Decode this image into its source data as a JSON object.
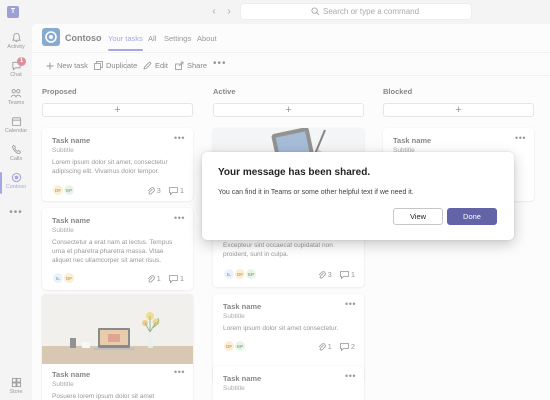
{
  "titlebar": {
    "search_placeholder": "Search or type a command"
  },
  "rail": {
    "items": [
      {
        "label": "Activity",
        "icon": "bell-icon"
      },
      {
        "label": "Chat",
        "icon": "chat-icon",
        "badge": "1"
      },
      {
        "label": "Teams",
        "icon": "teams-icon"
      },
      {
        "label": "Calendar",
        "icon": "calendar-icon"
      },
      {
        "label": "Calls",
        "icon": "phone-icon"
      },
      {
        "label": "Contoso",
        "icon": "contoso-app-icon"
      }
    ],
    "more": "•••",
    "store": "Store"
  },
  "app": {
    "name": "Contoso",
    "tabs": [
      "Your tasks",
      "All",
      "Settings",
      "About"
    ],
    "active_tab": "Your tasks"
  },
  "toolbar": {
    "new_task": "New task",
    "duplicate": "Duplicate",
    "edit": "Edit",
    "share": "Share",
    "more": "•••"
  },
  "columns": [
    {
      "title": "Proposed",
      "add": "+",
      "cards": [
        {
          "title": "Task name",
          "subtitle": "Subtitle",
          "desc": "Lorem ipsum dolor sit amet, consectetur adipiscing elit. Vivamus dolor tempor.",
          "avatars": [
            "DF",
            "EP"
          ],
          "attachments": "3",
          "comments": "1"
        },
        {
          "title": "Task name",
          "subtitle": "Subtitle",
          "desc": "Consectetur a erat nam at lectus. Tempus urna et pharetra pharetra massa. Vitae aliquet nec ullamcorper sit amet risus.",
          "avatars": [
            "IL",
            "DF"
          ],
          "attachments": "1",
          "comments": "1"
        },
        {
          "title": "Task name",
          "subtitle": "Subtitle",
          "desc": "Posuere lorem ipsum dolor sit amet consectetur."
        }
      ]
    },
    {
      "title": "Active",
      "add": "+",
      "cards": [
        {
          "desc": "Excepteur sint occaecat cupidatat non proident, sunt in culpa.",
          "avatars": [
            "IL",
            "DF",
            "EP"
          ],
          "attachments": "3",
          "comments": "1"
        },
        {
          "title": "Task name",
          "subtitle": "Subtitle",
          "desc": "Lorem ipsum dolor sit amet consectetur.",
          "avatars": [
            "DF",
            "EP"
          ],
          "attachments": "1",
          "comments": "2"
        },
        {
          "title": "Task name",
          "subtitle": "Subtitle"
        }
      ]
    },
    {
      "title": "Blocked",
      "add": "+",
      "cards": [
        {
          "title": "Task name",
          "subtitle": "Subtitle"
        }
      ]
    }
  ],
  "dialog": {
    "title": "Your message has been shared.",
    "text": "You can find it in Teams or some other helpful text if we need it.",
    "view": "View",
    "done": "Done"
  },
  "colors": {
    "accent": "#5b5fc7",
    "primary_button": "#6264a7",
    "badge": "#c4314b"
  }
}
